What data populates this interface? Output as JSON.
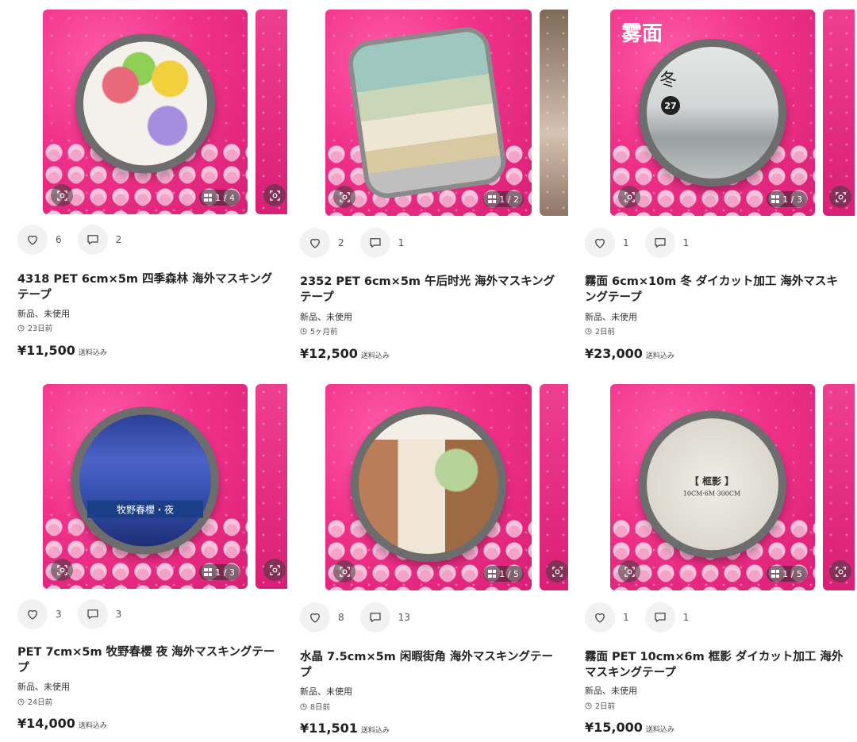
{
  "listings": [
    {
      "title": "4318 PET 6cm×5m 四季森林 海外マスキングテープ",
      "condition": "新品、未使用",
      "time": "23日前",
      "price": "¥11,500",
      "shipping": "送料込み",
      "likes": "6",
      "comments": "2",
      "image_counter": "1 / 4",
      "image_theme": "four-season-trees"
    },
    {
      "title": "2352 PET 6cm×5m 午后时光 海外マスキングテープ",
      "condition": "新品、未使用",
      "time": "5ヶ月前",
      "price": "¥12,500",
      "shipping": "送料込み",
      "likes": "2",
      "comments": "1",
      "image_counter": "1 / 2",
      "image_theme": "afternoon-botanical-rolls"
    },
    {
      "title": "霧面 6cm×10m 冬 ダイカット加工 海外マスキングテープ",
      "condition": "新品、未使用",
      "time": "2日前",
      "price": "¥23,000",
      "shipping": "送料込み",
      "likes": "1",
      "comments": "1",
      "image_counter": "1 / 3",
      "image_overlay": "雾面",
      "image_kanji": "冬",
      "image_badge": "27",
      "image_theme": "winter-grass"
    },
    {
      "title": "PET 7cm×5m 牧野春櫻 夜 海外マスキングテープ",
      "condition": "新品、未使用",
      "time": "24日前",
      "price": "¥14,000",
      "shipping": "送料込み",
      "likes": "3",
      "comments": "3",
      "image_counter": "1 / 3",
      "image_band": "牧野春櫻・夜",
      "image_theme": "night-castle-blue"
    },
    {
      "title": "水晶 7.5cm×5m 闲暇街角 海外マスキングテープ",
      "condition": "新品、未使用",
      "time": "8日前",
      "price": "¥11,501",
      "shipping": "送料込み",
      "likes": "8",
      "comments": "13",
      "image_counter": "1 / 5",
      "image_theme": "street-cafe"
    },
    {
      "title": "霧面 PET 10cm×6m 框影 ダイカット加工 海外マスキングテープ",
      "condition": "新品、未使用",
      "time": "2日前",
      "price": "¥15,000",
      "shipping": "送料込み",
      "likes": "1",
      "comments": "1",
      "image_counter": "1 / 5",
      "image_label": "【 框影 】",
      "image_spec": "10CM·6M·300CM",
      "image_theme": "film-frames"
    }
  ],
  "colors": {
    "background": "#ffffff",
    "photo_pink": "#f0318a",
    "text": "#222222",
    "icon_bg": "#f2f2f2"
  },
  "icons": {
    "like": "heart-icon",
    "comment": "comment-icon",
    "lens": "image-search-icon",
    "counter": "grid-icon",
    "time": "clock-icon"
  }
}
